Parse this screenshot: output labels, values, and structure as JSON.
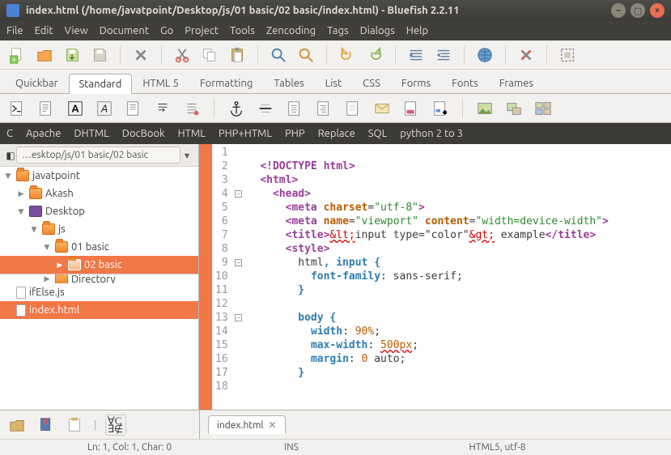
{
  "window": {
    "title": "index.html (/home/javatpoint/Desktop/js/01 basic/02 basic/index.html) - Bluefish 2.2.11"
  },
  "menubar": [
    "File",
    "Edit",
    "View",
    "Document",
    "Go",
    "Project",
    "Tools",
    "Zencoding",
    "Tags",
    "Dialogs",
    "Help"
  ],
  "tabs": [
    "Quickbar",
    "Standard",
    "HTML 5",
    "Formatting",
    "Tables",
    "List",
    "CSS",
    "Forms",
    "Fonts",
    "Frames"
  ],
  "active_tab": "Standard",
  "darkbar": [
    "C",
    "Apache",
    "DHTML",
    "DocBook",
    "HTML",
    "PHP+HTML",
    "PHP",
    "Replace",
    "SQL",
    "python 2 to 3"
  ],
  "breadcrumb": "…esktop/js/01 basic/02 basic",
  "tree": {
    "nodes": [
      {
        "label": "javatpoint",
        "type": "folder",
        "depth": 0,
        "expanded": true
      },
      {
        "label": "Akash",
        "type": "folder",
        "depth": 1,
        "expanded": false
      },
      {
        "label": "Desktop",
        "type": "desktop",
        "depth": 1,
        "expanded": true
      },
      {
        "label": "js",
        "type": "folder",
        "depth": 2,
        "expanded": true
      },
      {
        "label": "01 basic",
        "type": "folder",
        "depth": 3,
        "expanded": true
      },
      {
        "label": "02 basic",
        "type": "folder",
        "depth": 4,
        "expanded": false,
        "selected": true
      },
      {
        "label": "Directory",
        "type": "folder",
        "depth": 3,
        "expanded": false,
        "cut": true
      },
      {
        "label": "ifElse.js",
        "type": "file",
        "depth": 0
      },
      {
        "label": "index.html",
        "type": "file",
        "depth": 0,
        "highlight": true
      }
    ]
  },
  "editor": {
    "lines": [
      1,
      2,
      3,
      4,
      5,
      6,
      7,
      8,
      9,
      10,
      11,
      12,
      13,
      14,
      15,
      16,
      17,
      18
    ],
    "fold_at": [
      4,
      9,
      13
    ]
  },
  "doc_tab": "index.html",
  "status": {
    "pos": "Ln: 1, Col: 1, Char: 0",
    "mode": "INS",
    "enc": "HTML5, utf-8"
  }
}
